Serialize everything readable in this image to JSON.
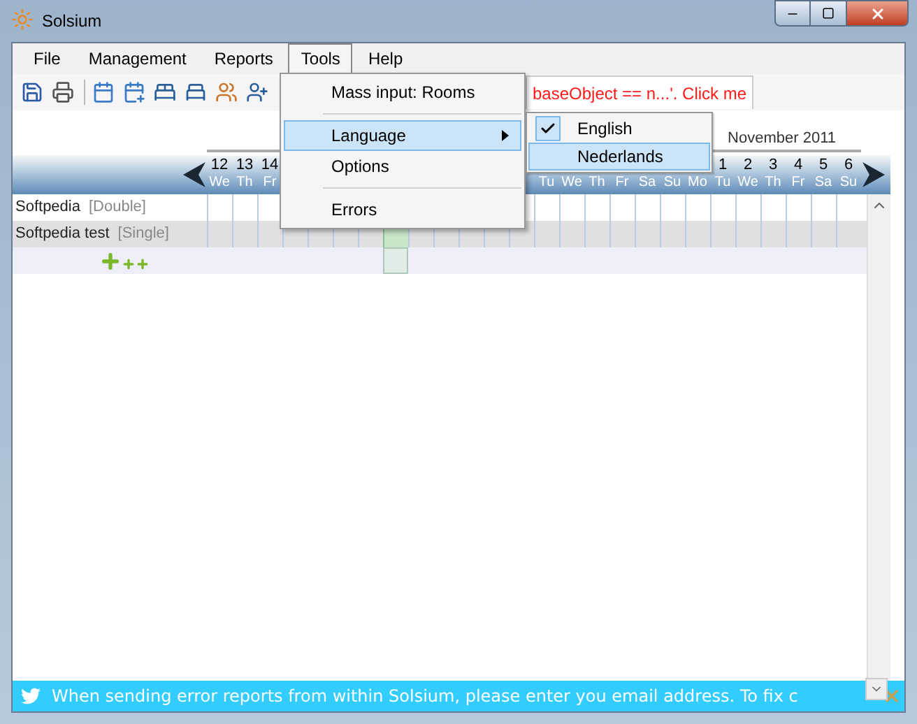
{
  "window": {
    "title": "Solsium"
  },
  "menu_bar": [
    {
      "label": "File",
      "selected": false
    },
    {
      "label": "Management",
      "selected": false
    },
    {
      "label": "Reports",
      "selected": false
    },
    {
      "label": "Tools",
      "selected": true
    },
    {
      "label": "Help",
      "selected": false
    }
  ],
  "error_tab": {
    "text": "baseObject == n...'. Click me"
  },
  "calendar": {
    "month": "November 2011",
    "days": [
      {
        "number": "12",
        "weekday": "We",
        "selected": false
      },
      {
        "number": "13",
        "weekday": "Th",
        "selected": false
      },
      {
        "number": "14",
        "weekday": "Fr",
        "selected": false
      },
      {
        "selected": false
      },
      {
        "selected": false
      },
      {
        "selected": false
      },
      {
        "selected": false
      },
      {
        "selected": true
      },
      {
        "selected": false
      },
      {
        "selected": false
      },
      {
        "selected": false
      },
      {
        "selected": false
      },
      {
        "selected": false
      },
      {
        "weekday": "Tu",
        "selected": false
      },
      {
        "weekday": "We",
        "selected": false
      },
      {
        "weekday": "Th",
        "selected": false
      },
      {
        "weekday": "Fr",
        "selected": false
      },
      {
        "weekday": "Sa",
        "selected": false
      },
      {
        "weekday": "Su",
        "selected": false
      },
      {
        "weekday": "Mo",
        "selected": false
      },
      {
        "number": "1",
        "weekday": "Tu",
        "selected": false
      },
      {
        "number": "2",
        "weekday": "We",
        "selected": false
      },
      {
        "number": "3",
        "weekday": "Th",
        "selected": false
      },
      {
        "number": "4",
        "weekday": "Fr",
        "selected": false
      },
      {
        "number": "5",
        "weekday": "Sa",
        "selected": false
      },
      {
        "number": "6",
        "weekday": "Su",
        "selected": false
      }
    ],
    "rooms": [
      {
        "name": "Softpedia",
        "type": "[Double]"
      },
      {
        "name": "Softpedia test",
        "type": "[Single]"
      }
    ]
  },
  "tools_menu": [
    {
      "kind": "item",
      "label": "Mass input: Rooms",
      "selected": false
    },
    {
      "kind": "separator"
    },
    {
      "kind": "submenu",
      "label": "Language",
      "selected": true
    },
    {
      "kind": "item",
      "label": "Options",
      "selected": false
    },
    {
      "kind": "separator"
    },
    {
      "kind": "item",
      "label": "Errors",
      "selected": false
    }
  ],
  "language_menu": [
    {
      "label": "English",
      "checked": true,
      "selected": false
    },
    {
      "label": "Nederlands",
      "checked": false,
      "selected": true
    }
  ],
  "banner": {
    "text": "When sending error reports from within Solsium, please enter you email address. To fix c"
  }
}
